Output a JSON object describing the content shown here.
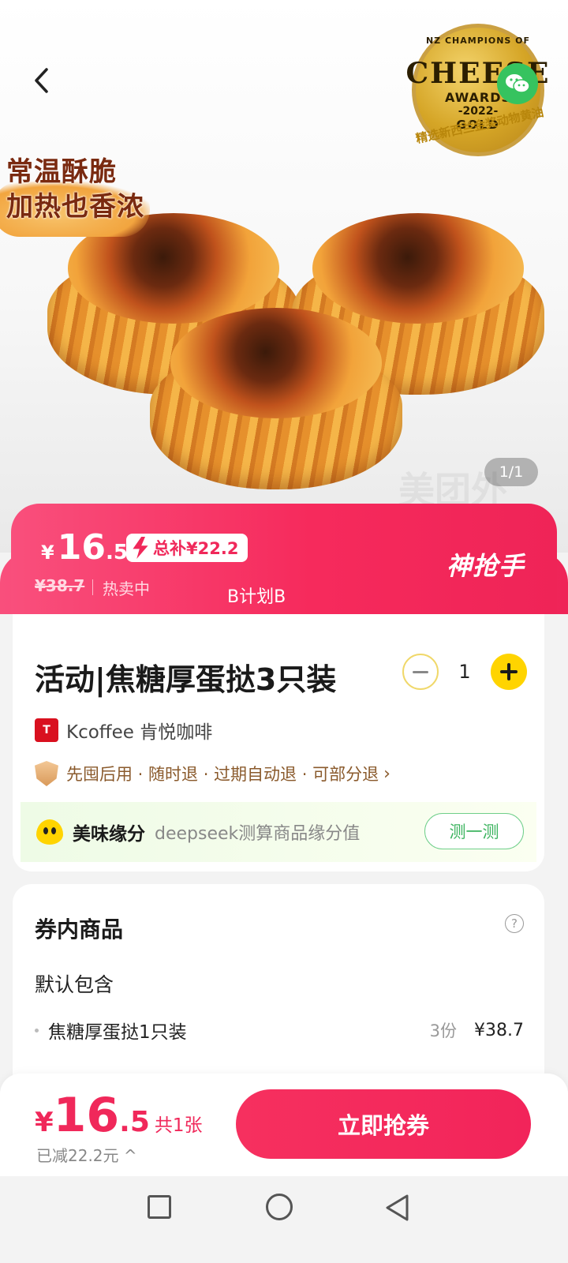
{
  "hero": {
    "tagline_line1": "常温酥脆",
    "tagline_line2": "加热也香浓",
    "badge_top": "NZ CHAMPIONS OF",
    "badge_main": "CHEESE",
    "badge_sub": "AWARDS",
    "badge_year": "-2022-",
    "badge_gold": "GOLD",
    "badge_caption": "精选新西兰金奖动物黄油",
    "pager": "1/1",
    "watermark": "美团外"
  },
  "promo": {
    "currency": "¥",
    "price_int": "16",
    "price_dec": ".5",
    "subsidy": "总补¥22.2",
    "original_price": "¥38.7",
    "status": "热卖中",
    "plan": "B计划B",
    "brand": "神抢手"
  },
  "product": {
    "title": "活动|焦糖厚蛋挞3只装",
    "quantity": "1",
    "shop_logo": "T",
    "shop_name": "Kcoffee 肯悦咖啡",
    "guarantee": "先囤后用 · 随时退 · 过期自动退 · 可部分退",
    "fate_label": "美味缘分",
    "fate_desc": "deepseek测算商品缘分值",
    "fate_button": "测一测"
  },
  "coupon": {
    "section_title": "券内商品",
    "help": "?",
    "default_label": "默认包含",
    "items": [
      {
        "name": "焦糖厚蛋挞1只装",
        "qty": "3份",
        "price": "¥38.7"
      }
    ]
  },
  "action": {
    "currency": "¥",
    "price_int": "16",
    "price_dec": ".5",
    "count": "共1张",
    "reduced": "已减22.2元 ^",
    "buy_label": "立即抢券"
  },
  "colors": {
    "primary": "#f0285a",
    "accent": "#ffd400"
  }
}
